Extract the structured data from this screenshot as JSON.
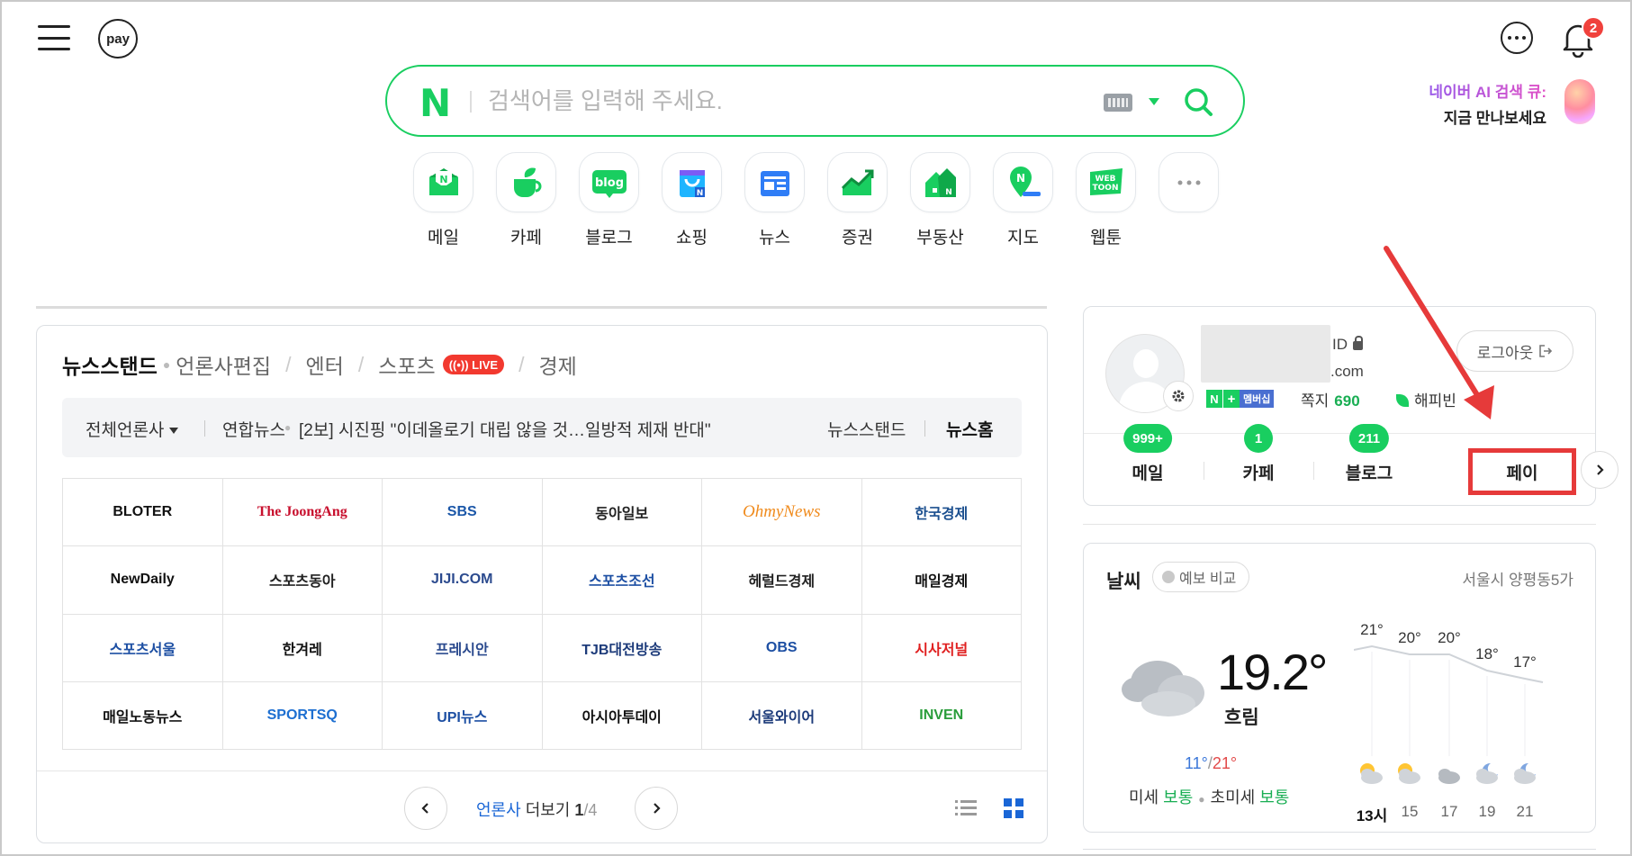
{
  "header": {
    "pay_label": "pay",
    "notification_count": "2",
    "ai_promo_line1": "네이버 AI 검색 큐:",
    "ai_promo_line2": "지금 만나보세요"
  },
  "search": {
    "logo": "N",
    "placeholder": "검색어를 입력해 주세요."
  },
  "shortcuts": [
    {
      "label": "메일",
      "icon": "mail-icon"
    },
    {
      "label": "카페",
      "icon": "cafe-icon"
    },
    {
      "label": "블로그",
      "icon": "blog-icon"
    },
    {
      "label": "쇼핑",
      "icon": "shopping-icon"
    },
    {
      "label": "뉴스",
      "icon": "news-icon"
    },
    {
      "label": "증권",
      "icon": "stock-icon"
    },
    {
      "label": "부동산",
      "icon": "realestate-icon"
    },
    {
      "label": "지도",
      "icon": "map-icon"
    },
    {
      "label": "웹툰",
      "icon": "webtoon-icon"
    },
    {
      "label": "",
      "icon": "more-icon"
    }
  ],
  "news": {
    "tabs": {
      "newsstand": "뉴스스탠드",
      "press_edit": "언론사편집",
      "enter": "엔터",
      "sports": "스포츠",
      "live": "LIVE",
      "economy": "경제"
    },
    "ticker": {
      "all_press": "전체언론사",
      "source": "연합뉴스",
      "headline": "[2보] 시진핑 \"이데올로기 대립 않을 것…일방적 제재 반대\"",
      "newsstand_link": "뉴스스탠드",
      "news_home": "뉴스홈"
    },
    "press": [
      {
        "name": "BLOTER",
        "color": "#111"
      },
      {
        "name": "The JoongAng",
        "color": "#c8102e"
      },
      {
        "name": "SBS",
        "color": "#1b57a8"
      },
      {
        "name": "동아일보",
        "color": "#222"
      },
      {
        "name": "OhmyNews",
        "color": "#f08b1d"
      },
      {
        "name": "한국경제",
        "color": "#1b4f8f"
      },
      {
        "name": "NewDaily",
        "color": "#111"
      },
      {
        "name": "스포츠동아",
        "color": "#222"
      },
      {
        "name": "JIJI.COM",
        "color": "#2b4a8e"
      },
      {
        "name": "스포츠조선",
        "color": "#1d4fa3"
      },
      {
        "name": "헤럴드경제",
        "color": "#222"
      },
      {
        "name": "매일경제",
        "color": "#111"
      },
      {
        "name": "스포츠서울",
        "color": "#1d4fa3"
      },
      {
        "name": "한겨레",
        "color": "#111"
      },
      {
        "name": "프레시안",
        "color": "#2b4a8e"
      },
      {
        "name": "TJB대전방송",
        "color": "#1d3b7a"
      },
      {
        "name": "OBS",
        "color": "#1d4fa3"
      },
      {
        "name": "시사저널",
        "color": "#e02020"
      },
      {
        "name": "매일노동뉴스",
        "color": "#111"
      },
      {
        "name": "SPORTSQ",
        "color": "#1d6fd1"
      },
      {
        "name": "UPI뉴스",
        "color": "#1d4fa3"
      },
      {
        "name": "아시아투데이",
        "color": "#111"
      },
      {
        "name": "서울와이어",
        "color": "#1d3b7a"
      },
      {
        "name": "INVEN",
        "color": "#2a9d3b"
      }
    ],
    "more": {
      "label_a": "언론사",
      "label_b": " 더보기 ",
      "page": "1",
      "total": "/4"
    }
  },
  "profile": {
    "id_suffix": "ID",
    "email_suffix": ".com",
    "membership": "멤버십",
    "notes_label": "쪽지",
    "notes_count": "690",
    "happybean": "해피빈",
    "logout": "로그아웃",
    "services": [
      {
        "label": "메일",
        "count": "999+"
      },
      {
        "label": "카페",
        "count": "1"
      },
      {
        "label": "블로그",
        "count": "211"
      },
      {
        "label": "페이",
        "count": ""
      }
    ]
  },
  "weather": {
    "title": "날씨",
    "compare": "예보 비교",
    "location": "서울시 양평동5가",
    "temp": "19.2°",
    "condition": "흐림",
    "min": "11°",
    "max": "21°",
    "dust_label": "미세",
    "dust_value": "보통",
    "ultra_label": "초미세",
    "ultra_value": "보통",
    "hourly": [
      {
        "time": "13시",
        "temp": "21°"
      },
      {
        "time": "15",
        "temp": "20°"
      },
      {
        "time": "17",
        "temp": "20°"
      },
      {
        "time": "19",
        "temp": "18°"
      },
      {
        "time": "21",
        "temp": "17°"
      }
    ]
  },
  "colors": {
    "brand_green": "#19ce60",
    "annotation_red": "#e63a3a",
    "live_red": "#f2392f"
  }
}
